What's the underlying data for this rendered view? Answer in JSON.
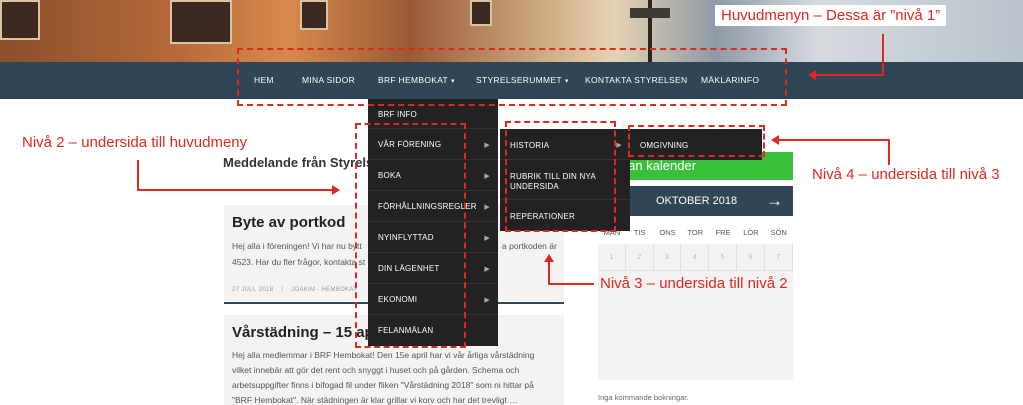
{
  "nav": {
    "items": [
      {
        "label": "HEM"
      },
      {
        "label": "MINA SIDOR"
      },
      {
        "label": "BRF HEMBOKAT",
        "caret": "▾"
      },
      {
        "label": "STYRELSERUMMET",
        "caret": "▾"
      },
      {
        "label": "KONTAKTA STYRELSEN"
      },
      {
        "label": "MÄKLARINFO"
      }
    ]
  },
  "menu_level2": {
    "items": [
      {
        "label": "BRF INFO",
        "arrow": ""
      },
      {
        "label": "VÅR FÖRENING",
        "arrow": "▶"
      },
      {
        "label": "BOKA",
        "arrow": "▶"
      },
      {
        "label": "FÖRHÅLLNINGSREGLER",
        "arrow": "▶"
      },
      {
        "label": "NYINFLYTTAD",
        "arrow": "▶"
      },
      {
        "label": "DIN LÄGENHET",
        "arrow": "▶"
      },
      {
        "label": "EKONOMI",
        "arrow": "▶"
      },
      {
        "label": "FELANMÄLAN",
        "arrow": ""
      }
    ]
  },
  "menu_level3": {
    "items": [
      {
        "label": "HISTORIA",
        "arrow": "▶"
      },
      {
        "label": "RUBRIK TILL DIN NYA",
        "label2": "UNDERSIDA",
        "arrow": ""
      },
      {
        "label": "REPERATIONER",
        "arrow": ""
      }
    ]
  },
  "menu_level4": {
    "items": [
      {
        "label": "OMGIVNING"
      }
    ]
  },
  "annotations": {
    "main": "Huvudmenyn – Dessa är ”nivå 1”",
    "level2": "Nivå 2 – undersida till huvudmeny",
    "level3": "Nivå 3 – undersida till nivå 2",
    "level4": "Nivå 4 – undersida till nivå 3"
  },
  "content": {
    "heading": "Meddelande från Styrelse",
    "posts": [
      {
        "title": "Byte av portkod",
        "text1": "Hej alla i föreningen! Vi har nu bytt",
        "text1b": "a portkoden är",
        "text2": "4523. Har du fler frågor, kontakta st",
        "meta_date": "27 JULI, 2018",
        "meta_sep": "/",
        "meta_author": "JOAKIM - HEMBOKAT"
      },
      {
        "title": "Vårstädning – 15 apr",
        "text1": "Hej alla medlemmar i BRF Hembokat! Den 15e april har vi vår årliga vårstädning",
        "text2": "vilket innebär att gör det rent och snyggt i huset och på gården. Schema och",
        "text3": "arbetsuppgifter finns i bifogad fil under fliken \"Vårstädning 2018\" som ni hittar på",
        "text4": "\"BRF Hembokat\". När städningen är klar grillar vi korv och har det trevligt …"
      }
    ]
  },
  "sidebar": {
    "calendar_link": "plan kalender",
    "calendar_month": "OKTOBER 2018",
    "next_icon": "→",
    "weekdays": [
      "MÅN",
      "TIS",
      "ONS",
      "TOR",
      "FRE",
      "LÖR",
      "SÖN"
    ],
    "week1": [
      "1",
      "2",
      "3",
      "4",
      "5",
      "6",
      "7"
    ],
    "empty_note": "Inga kommande bokningar."
  },
  "colors": {
    "navbar": "#2f4656",
    "annotation_red": "#e0281e",
    "menu_bg": "#222222",
    "calendar_green": "#3ac03a"
  }
}
